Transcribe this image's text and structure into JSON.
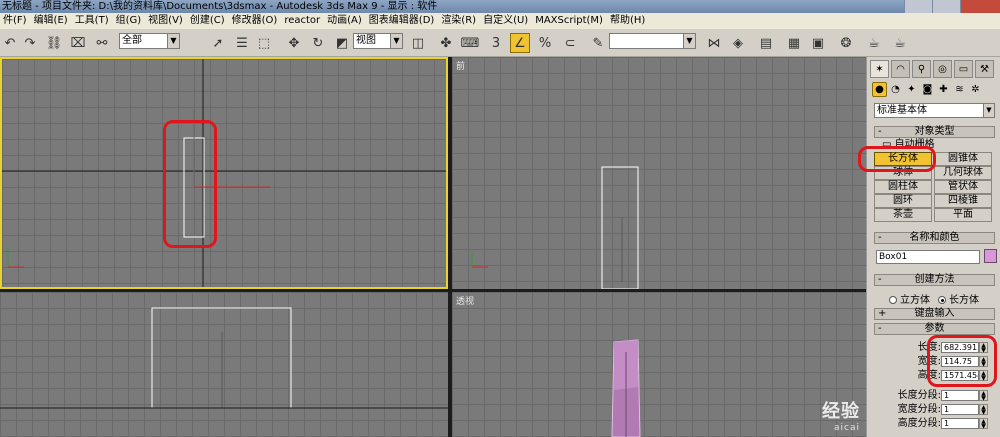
{
  "window": {
    "title": "无标题    - 项目文件夹: D:\\我的资料库\\Documents\\3dsmax    - Autodesk 3ds Max 9    - 显示 : 软件"
  },
  "menu": [
    {
      "label": "件(F)"
    },
    {
      "label": "编辑(E)"
    },
    {
      "label": "工具(T)"
    },
    {
      "label": "组(G)"
    },
    {
      "label": "视图(V)"
    },
    {
      "label": "创建(C)"
    },
    {
      "label": "修改器(O)"
    },
    {
      "label": "reactor"
    },
    {
      "label": "动画(A)"
    },
    {
      "label": "图表编辑器(D)"
    },
    {
      "label": "渲染(R)"
    },
    {
      "label": "自定义(U)"
    },
    {
      "label": "MAXScript(M)"
    },
    {
      "label": "帮助(H)"
    }
  ],
  "toolbar": {
    "selection_filter": "全部",
    "ref_coord": "视图",
    "named_selection": "",
    "snap_percent_label": "%",
    "snap_angle_label": "3"
  },
  "viewports": {
    "top_left": {
      "label": ""
    },
    "top_right": {
      "label": "前"
    },
    "bottom_left": {
      "label": ""
    },
    "bottom_right": {
      "label": "透视"
    }
  },
  "command_panel": {
    "category": "标准基本体",
    "object_type": {
      "title": "对象类型",
      "autogrid": "自动栅格",
      "buttons": [
        {
          "label": "长方体",
          "active": true
        },
        {
          "label": "圆锥体"
        },
        {
          "label": "球体"
        },
        {
          "label": "几何球体"
        },
        {
          "label": "圆柱体"
        },
        {
          "label": "管状体"
        },
        {
          "label": "圆环"
        },
        {
          "label": "四棱锥"
        },
        {
          "label": "茶壶"
        },
        {
          "label": "平面"
        }
      ]
    },
    "name_color": {
      "title": "名称和颜色",
      "name": "Box01",
      "color": "#d898d8"
    },
    "creation_method": {
      "title": "创建方法",
      "options": [
        "立方体",
        "长方体"
      ],
      "selected": "长方体"
    },
    "keyboard_entry": {
      "title": "键盘输入"
    },
    "parameters": {
      "title": "参数",
      "rows": [
        {
          "label": "长度:",
          "value": "682.391"
        },
        {
          "label": "宽度:",
          "value": "114.75"
        },
        {
          "label": "高度:",
          "value": "1571.454"
        },
        {
          "label": "长度分段:",
          "value": "1"
        },
        {
          "label": "宽度分段:",
          "value": "1"
        },
        {
          "label": "高度分段:",
          "value": "1"
        }
      ]
    }
  },
  "watermark": {
    "main": "经验",
    "sub": "aicai"
  }
}
